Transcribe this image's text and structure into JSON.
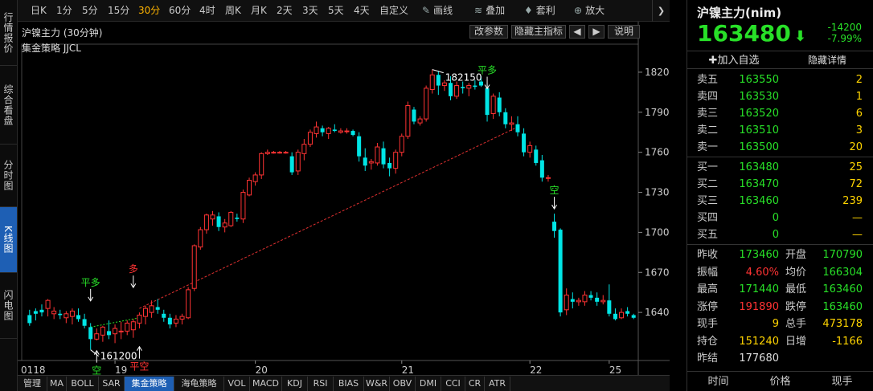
{
  "left_tabs": [
    "行情报价",
    "综合看盘",
    "分时图",
    "K线图",
    "闪电图"
  ],
  "toolbar": {
    "periods": [
      "日K",
      "1分",
      "5分",
      "15分",
      "30分",
      "60分",
      "4时",
      "周K",
      "月K",
      "2天",
      "3天",
      "5天",
      "4天",
      "自定义"
    ],
    "active_period": "30分",
    "tools": [
      "画线",
      "叠加",
      "套利",
      "放大"
    ]
  },
  "chart": {
    "title": "沪镍主力 (30分钟)",
    "strategy": "集金策略 JJCL",
    "btn_params": "改参数",
    "btn_hide_ind": "隐藏主指标",
    "btn_left": "◀",
    "btn_right": "▶",
    "btn_help": "说明",
    "max_label": "182150",
    "min_label": "161200"
  },
  "chart_data": {
    "type": "candlestick",
    "y_ticks": [
      "182000",
      "179000",
      "176000",
      "173000",
      "170000",
      "167000",
      "164000"
    ],
    "x_labels": [
      "0118",
      "19",
      "20",
      "21",
      "22",
      "25"
    ],
    "ylim": [
      161000,
      183500
    ],
    "candles": [
      [
        163800,
        164200,
        163000,
        163200
      ],
      [
        164100,
        164300,
        163400,
        163900
      ],
      [
        164200,
        164600,
        163700,
        164000
      ],
      [
        164300,
        165000,
        163700,
        164900
      ],
      [
        163900,
        164400,
        163500,
        164100
      ],
      [
        163900,
        164200,
        163500,
        163800
      ],
      [
        163600,
        164100,
        163200,
        163900
      ],
      [
        163700,
        164300,
        163100,
        164100
      ],
      [
        163800,
        164300,
        163300,
        163500
      ],
      [
        163500,
        163900,
        162800,
        163000
      ],
      [
        162900,
        163200,
        161200,
        162000
      ],
      [
        162000,
        162800,
        161900,
        162400
      ],
      [
        162300,
        163000,
        161800,
        162900
      ],
      [
        162600,
        163400,
        162000,
        162300
      ],
      [
        162400,
        163100,
        161700,
        162800
      ],
      [
        162600,
        163300,
        162000,
        162600
      ],
      [
        162600,
        163400,
        162300,
        163200
      ],
      [
        162700,
        163500,
        162100,
        163300
      ],
      [
        163200,
        164000,
        162800,
        163800
      ],
      [
        163700,
        164500,
        163100,
        164300
      ],
      [
        164000,
        164900,
        163600,
        164500
      ],
      [
        164400,
        165000,
        163900,
        164200
      ],
      [
        163900,
        164200,
        163300,
        163600
      ],
      [
        163600,
        163900,
        162800,
        163100
      ],
      [
        163200,
        163800,
        162900,
        163500
      ],
      [
        163500,
        163900,
        163100,
        163700
      ],
      [
        163600,
        165900,
        163500,
        165700
      ],
      [
        165800,
        169100,
        165600,
        169000
      ],
      [
        168900,
        170400,
        168700,
        170200
      ],
      [
        170200,
        171400,
        169900,
        171300
      ],
      [
        171000,
        171600,
        170500,
        171300
      ],
      [
        171200,
        171500,
        170100,
        170400
      ],
      [
        170400,
        171000,
        170000,
        170700
      ],
      [
        170500,
        171600,
        170400,
        171500
      ],
      [
        171100,
        171400,
        170800,
        171000
      ],
      [
        171000,
        173200,
        170700,
        173000
      ],
      [
        172800,
        174100,
        172700,
        173900
      ],
      [
        173800,
        174500,
        173500,
        174300
      ],
      [
        174300,
        176000,
        174000,
        175900
      ],
      [
        175900,
        176200,
        175800,
        176000
      ],
      [
        176000,
        176100,
        175900,
        176000
      ],
      [
        176000,
        176100,
        175900,
        176000
      ],
      [
        176000,
        176100,
        175900,
        176000
      ],
      [
        175700,
        176000,
        174300,
        174500
      ],
      [
        174600,
        176200,
        174300,
        176000
      ],
      [
        175900,
        177000,
        175400,
        176600
      ],
      [
        176600,
        177700,
        176400,
        177500
      ],
      [
        177400,
        178300,
        177100,
        177900
      ],
      [
        177800,
        178000,
        177200,
        177500
      ],
      [
        177400,
        177900,
        177000,
        177800
      ],
      [
        177700,
        178100,
        177500,
        177600
      ],
      [
        177500,
        177800,
        177400,
        177600
      ],
      [
        177600,
        177800,
        177400,
        177600
      ],
      [
        177600,
        177700,
        177200,
        177300
      ],
      [
        177200,
        177500,
        175300,
        175700
      ],
      [
        175600,
        176300,
        174600,
        175000
      ],
      [
        175200,
        175500,
        174700,
        175300
      ],
      [
        175200,
        176700,
        175000,
        176400
      ],
      [
        176300,
        176800,
        174800,
        175100
      ],
      [
        175200,
        175600,
        174200,
        174800
      ],
      [
        174800,
        176200,
        174400,
        176000
      ],
      [
        176000,
        177400,
        175700,
        177200
      ],
      [
        177200,
        179800,
        177000,
        179500
      ],
      [
        179200,
        179400,
        178100,
        178300
      ],
      [
        178200,
        178700,
        178000,
        178500
      ],
      [
        178500,
        181000,
        178300,
        180800
      ],
      [
        180700,
        182200,
        180400,
        181800
      ],
      [
        181800,
        182100,
        180300,
        181000
      ],
      [
        181000,
        181400,
        180600,
        181200
      ],
      [
        181200,
        181700,
        179900,
        180200
      ],
      [
        180200,
        181300,
        180000,
        181000
      ],
      [
        180900,
        181300,
        180400,
        180800
      ],
      [
        180800,
        181200,
        180200,
        181000
      ],
      [
        181000,
        181400,
        180700,
        180900
      ],
      [
        181300,
        181700,
        180900,
        181000
      ],
      [
        180800,
        181200,
        178300,
        178800
      ],
      [
        178900,
        180400,
        178500,
        180200
      ],
      [
        180100,
        180500,
        178700,
        179000
      ],
      [
        179000,
        179300,
        177800,
        178100
      ],
      [
        178100,
        178700,
        177600,
        178200
      ],
      [
        178100,
        178700,
        177200,
        177500
      ],
      [
        177400,
        177800,
        175700,
        176000
      ],
      [
        176000,
        176800,
        175600,
        176500
      ],
      [
        176200,
        176500,
        175000,
        175200
      ],
      [
        175400,
        175800,
        173800,
        174100
      ],
      [
        174100,
        174300,
        173800,
        174100
      ],
      [
        170800,
        171400,
        169600,
        170100
      ],
      [
        170200,
        170300,
        163700,
        164000
      ],
      [
        164200,
        165800,
        163800,
        165300
      ],
      [
        165000,
        165500,
        164300,
        164800
      ],
      [
        164800,
        165100,
        164500,
        164900
      ],
      [
        164800,
        165600,
        164500,
        165300
      ],
      [
        165300,
        165600,
        164900,
        165100
      ],
      [
        165100,
        165500,
        164500,
        164800
      ],
      [
        164800,
        165300,
        164600,
        164900
      ],
      [
        164900,
        166100,
        163700,
        163900
      ],
      [
        163900,
        164300,
        163400,
        163500
      ],
      [
        163600,
        164300,
        163500,
        164000
      ],
      [
        164100,
        164400,
        163700,
        163900
      ],
      [
        163800,
        163900,
        163500,
        163600
      ]
    ],
    "signals": [
      {
        "index": 10,
        "text": "平多",
        "color": "#28e028",
        "pos": "above",
        "price": 164800
      },
      {
        "index": 11,
        "text": "空",
        "color": "#28e028",
        "pos": "below",
        "price": 161200
      },
      {
        "index": 17,
        "text": "多",
        "color": "#ff3333",
        "pos": "above",
        "price": 165800
      },
      {
        "index": 18,
        "text": "平空",
        "color": "#ff3333",
        "pos": "below",
        "price": 161500
      },
      {
        "index": 75,
        "text": "平多",
        "color": "#28e028",
        "pos": "above",
        "price": 180700
      },
      {
        "index": 86,
        "text": "空",
        "color": "#28e028",
        "pos": "above",
        "price": 171700
      }
    ]
  },
  "bottom_tabs": [
    "管理",
    "MA",
    "BOLL",
    "SAR",
    "集金策略",
    "海龟策略",
    "VOL",
    "MACD",
    "KDJ",
    "RSI",
    "BIAS",
    "W&R",
    "OBV",
    "DMI",
    "CCI",
    "CR",
    "ATR"
  ],
  "active_bottom_tab": "集金策略",
  "quote": {
    "name": "沪镍主力(nim)",
    "price": "163480",
    "arrow": "⬇",
    "change": "-14200",
    "change_pct": "-7.99%",
    "add_btn": "✚加入自选",
    "hide_btn": "隐藏详情",
    "asks": [
      {
        "label": "卖五",
        "price": "163550",
        "vol": "2"
      },
      {
        "label": "卖四",
        "price": "163530",
        "vol": "1"
      },
      {
        "label": "卖三",
        "price": "163520",
        "vol": "6"
      },
      {
        "label": "卖二",
        "price": "163510",
        "vol": "3"
      },
      {
        "label": "卖一",
        "price": "163500",
        "vol": "20"
      }
    ],
    "bids": [
      {
        "label": "买一",
        "price": "163480",
        "vol": "25"
      },
      {
        "label": "买二",
        "price": "163470",
        "vol": "72"
      },
      {
        "label": "买三",
        "price": "163460",
        "vol": "239"
      },
      {
        "label": "买四",
        "price": "0",
        "vol": "—"
      },
      {
        "label": "买五",
        "price": "0",
        "vol": "—"
      }
    ],
    "stats": [
      {
        "l1": "昨收",
        "v1": "173460",
        "c1": "#28e028",
        "l2": "开盘",
        "v2": "170790",
        "c2": "#28e028"
      },
      {
        "l1": "振幅",
        "v1": "4.60%",
        "c1": "#ff3333",
        "l2": "均价",
        "v2": "166304",
        "c2": "#28e028"
      },
      {
        "l1": "最高",
        "v1": "171440",
        "c1": "#28e028",
        "l2": "最低",
        "v2": "163460",
        "c2": "#28e028"
      },
      {
        "l1": "涨停",
        "v1": "191890",
        "c1": "#ff3333",
        "l2": "跌停",
        "v2": "163460",
        "c2": "#28e028"
      },
      {
        "l1": "现手",
        "v1": "9",
        "c1": "#ffd400",
        "l2": "总手",
        "v2": "473178",
        "c2": "#ffd400"
      },
      {
        "l1": "持仓",
        "v1": "151240",
        "c1": "#ffd400",
        "l2": "日增",
        "v2": "-1166",
        "c2": "#ffd400"
      }
    ],
    "settle_label": "昨结",
    "settle_value": "177680",
    "footer": [
      "时间",
      "价格",
      "现手"
    ]
  },
  "colors": {
    "up": "#ff3333",
    "down": "#00e5e5",
    "green": "#28e028",
    "active_tab": "#1e5fb4"
  }
}
